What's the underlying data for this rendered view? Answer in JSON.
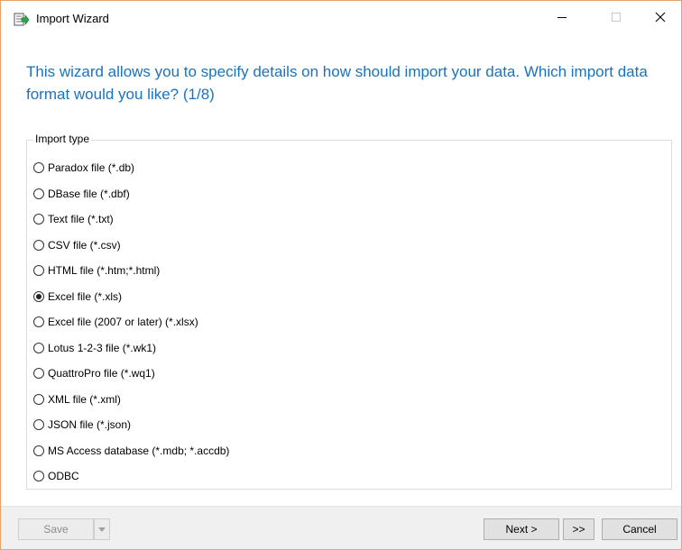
{
  "window": {
    "title": "Import Wizard"
  },
  "icons": {
    "app": "import-wizard-icon",
    "minimize": "minimize-icon",
    "maximize": "maximize-icon",
    "close": "close-icon",
    "dropdown": "chevron-down-icon"
  },
  "heading": "This wizard allows you to specify details on how should import your data. Which import data format would you like? (1/8)",
  "import_type": {
    "legend": "Import type",
    "selected_index": 5,
    "options": [
      {
        "label": "Paradox file (*.db)"
      },
      {
        "label": "DBase file (*.dbf)"
      },
      {
        "label": "Text file (*.txt)"
      },
      {
        "label": "CSV file (*.csv)"
      },
      {
        "label": "HTML file (*.htm;*.html)"
      },
      {
        "label": "Excel file (*.xls)"
      },
      {
        "label": "Excel file (2007 or later) (*.xlsx)"
      },
      {
        "label": "Lotus 1-2-3 file (*.wk1)"
      },
      {
        "label": "QuattroPro file (*.wq1)"
      },
      {
        "label": "XML file (*.xml)"
      },
      {
        "label": "JSON file (*.json)"
      },
      {
        "label": "MS Access database (*.mdb; *.accdb)"
      },
      {
        "label": "ODBC"
      }
    ]
  },
  "buttons": {
    "save": "Save",
    "next": "Next >",
    "skip": ">>",
    "cancel": "Cancel"
  },
  "colors": {
    "heading": "#1a73bf",
    "window_border": "#e8a36b",
    "footer_bg": "#f0f0f0"
  }
}
